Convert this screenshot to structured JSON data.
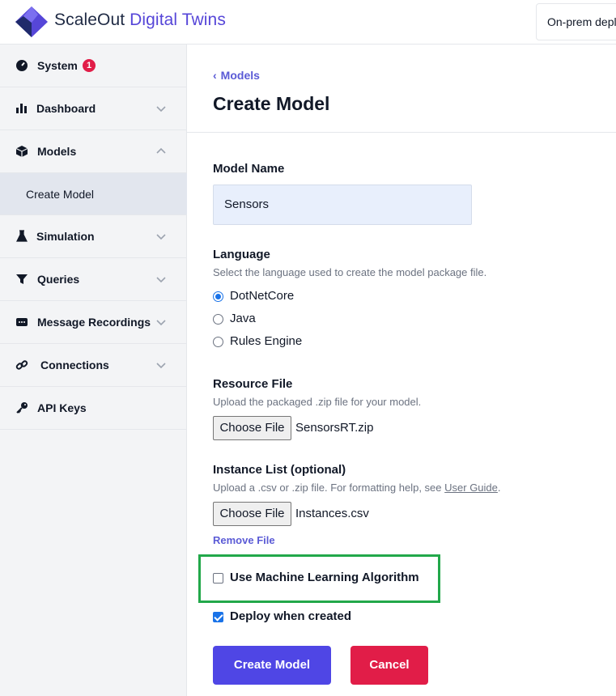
{
  "header": {
    "brand_part1": "ScaleOut",
    "brand_part2": "Digital Twins",
    "deployment_select": "On-prem depl"
  },
  "sidebar": {
    "items": [
      {
        "label": "System",
        "icon": "gauge-icon",
        "badge": "1"
      },
      {
        "label": "Dashboard",
        "icon": "bar-chart-icon"
      },
      {
        "label": "Models",
        "icon": "cube-icon"
      },
      {
        "label": "Simulation",
        "icon": "flask-icon"
      },
      {
        "label": "Queries",
        "icon": "filter-icon"
      },
      {
        "label": "Message Recordings",
        "icon": "message-icon"
      },
      {
        "label": "Connections",
        "icon": "link-icon"
      },
      {
        "label": "API Keys",
        "icon": "key-icon"
      }
    ],
    "sub_item": "Create Model"
  },
  "main": {
    "breadcrumb": "Models",
    "title": "Create Model",
    "model_name": {
      "label": "Model Name",
      "value": "Sensors"
    },
    "language": {
      "label": "Language",
      "help": "Select the language used to create the model package file.",
      "options": [
        "DotNetCore",
        "Java",
        "Rules Engine"
      ],
      "selected": "DotNetCore"
    },
    "resource_file": {
      "label": "Resource File",
      "help": "Upload the packaged .zip file for your model.",
      "button": "Choose File",
      "file": "SensorsRT.zip"
    },
    "instance_list": {
      "label": "Instance List (optional)",
      "help_prefix": "Upload a .csv or .zip file. For formatting help, see ",
      "help_link": "User Guide",
      "help_suffix": ".",
      "button": "Choose File",
      "file": "Instances.csv",
      "remove": "Remove File"
    },
    "use_ml": {
      "label": "Use Machine Learning Algorithm",
      "checked": false
    },
    "deploy": {
      "label": "Deploy when created",
      "checked": true
    },
    "create_button": "Create Model",
    "cancel_button": "Cancel"
  },
  "colors": {
    "accent": "#4f46e5",
    "danger": "#e11d48",
    "highlight": "#22a84a",
    "link": "#5b5bd6"
  }
}
